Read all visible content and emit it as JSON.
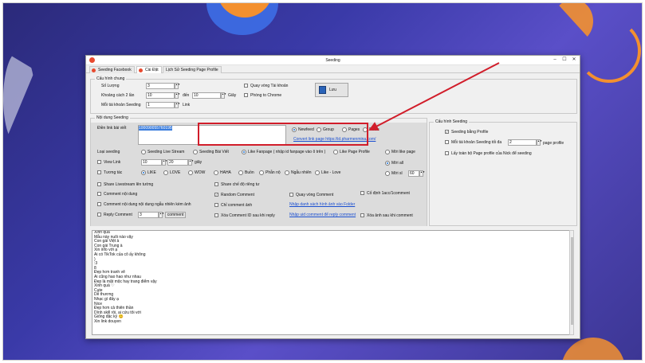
{
  "window": {
    "title": "Seeding",
    "min": "–",
    "max": "☐",
    "close": "✕"
  },
  "tabs": [
    "Seeding Facebook",
    "Cài Đặt",
    "Lịch Sử Seeding Page Profile"
  ],
  "cau_hinh_chung": {
    "label": "Cấu hình chung",
    "so_luong_label": "Số Lượng",
    "so_luong": "3",
    "khoang_cach_label": "Khoảng cách 2 lần",
    "khoang_from": "10",
    "den_label": "đến",
    "khoang_to": "10",
    "giay": "Giây",
    "moi_tk_label": "Mỗi tài khoản Seeding",
    "moi_tk": "1",
    "link_label": "Link",
    "quay_vong": "Quay vòng Tài khoản",
    "phong_chrome": "Phóng to Chrome",
    "luu": "Lưu"
  },
  "noi_dung": {
    "label": "Nội dung Seeding",
    "dien_link_label": "Điền link bài viết",
    "dien_link_value": "100090055760195",
    "newfeed": "Newfeed",
    "group": "Group",
    "pages": "Pages",
    "reels": "Reels",
    "convert_link": "Convert link page https://id.pharmenmina.com/",
    "loai_seeding_label": "Loại seeding",
    "live_stream": "Seeding Live Stream",
    "bai_viet": "Seeding Bài Viết",
    "like_fanpage": "Like Fanpage ( nhập id fanpage vào ô trên )",
    "like_page_profile": "Like Page Profile",
    "moi_like_page": "Mời like page",
    "view_link": "View Link",
    "view_from": "10",
    "view_to": "20",
    "giay": "giây",
    "moi_all": "Mời all",
    "moi_si": "Mời sl",
    "moi_si_val": "60",
    "tuong_tac": "Tương tác",
    "reactions": [
      "LIKE",
      "LOVE",
      "WOW",
      "HAHA",
      "Buồn",
      "Phẫn nộ",
      "Ngẫu nhiên",
      "Like - Love"
    ],
    "share_livestream": "Share Livestream lên tường",
    "share_che_do": "Share chế độ riêng tư",
    "comment_noi_dung": "Comment nội dung",
    "random_comment": "Random Comment",
    "quay_vong_comment": "Quay vòng Comment",
    "co_dinh": "Cố định 1acc/1comment",
    "comment_ngau_nhien": "Comment nội dung nội dung ngẫu nhiên kèm ảnh",
    "chi_comment_anh": "Chỉ comment ảnh",
    "nhap_danh_sach": "Nhập danh sách hình ảnh vào Folder",
    "reply_comment": "Reply Comment",
    "reply_val": "3",
    "comment_btn": "comment",
    "xoa_comment_id": "Xóa Comment ID sau khi reply",
    "nhap_uid": "Nhập uid comment để reply comment",
    "xoa_anh": "Xóa ảnh sau khi comment"
  },
  "cau_hinh_seeding": {
    "label": "Cấu hình Seeding",
    "seeding_bang_profile": "Seeding bằng Profile",
    "moi_tk_seeding": "Mỗi tài khoản Seeding tối đa",
    "moi_tk_seeding_val": "2",
    "page_profile": "page profile",
    "lay_toan_bo": "Lấy toàn bộ Page profile của Nick để seeding"
  },
  "comments": [
    "Xinh quá",
    "Mẫu này nuôi nào vậy",
    "Con gái Việt à",
    "Con gái Trung à",
    "Xin info với ạ",
    "Ai có TikTok của cô ấy không",
    ")",
    ":3",
    "8",
    "Đẹp hơn tranh vẽ",
    "Ai cũng hao hao như nhau",
    "Đẹp là mặt mộc hay trang điểm vậy",
    "Xinh quá ♡",
    "Cute",
    "Dễ thương",
    "Nhạc gì đấy ạ",
    "Nice",
    "Đẹp hơn cả thiên thần",
    "Dính skill rồi, ai cứu tôi với",
    "Giống đặc ký 😊",
    "Xin link douyen"
  ],
  "colors": {
    "highlight": "#d11d2a",
    "arrow": "#d11d2a",
    "link": "#1a4fd1"
  }
}
